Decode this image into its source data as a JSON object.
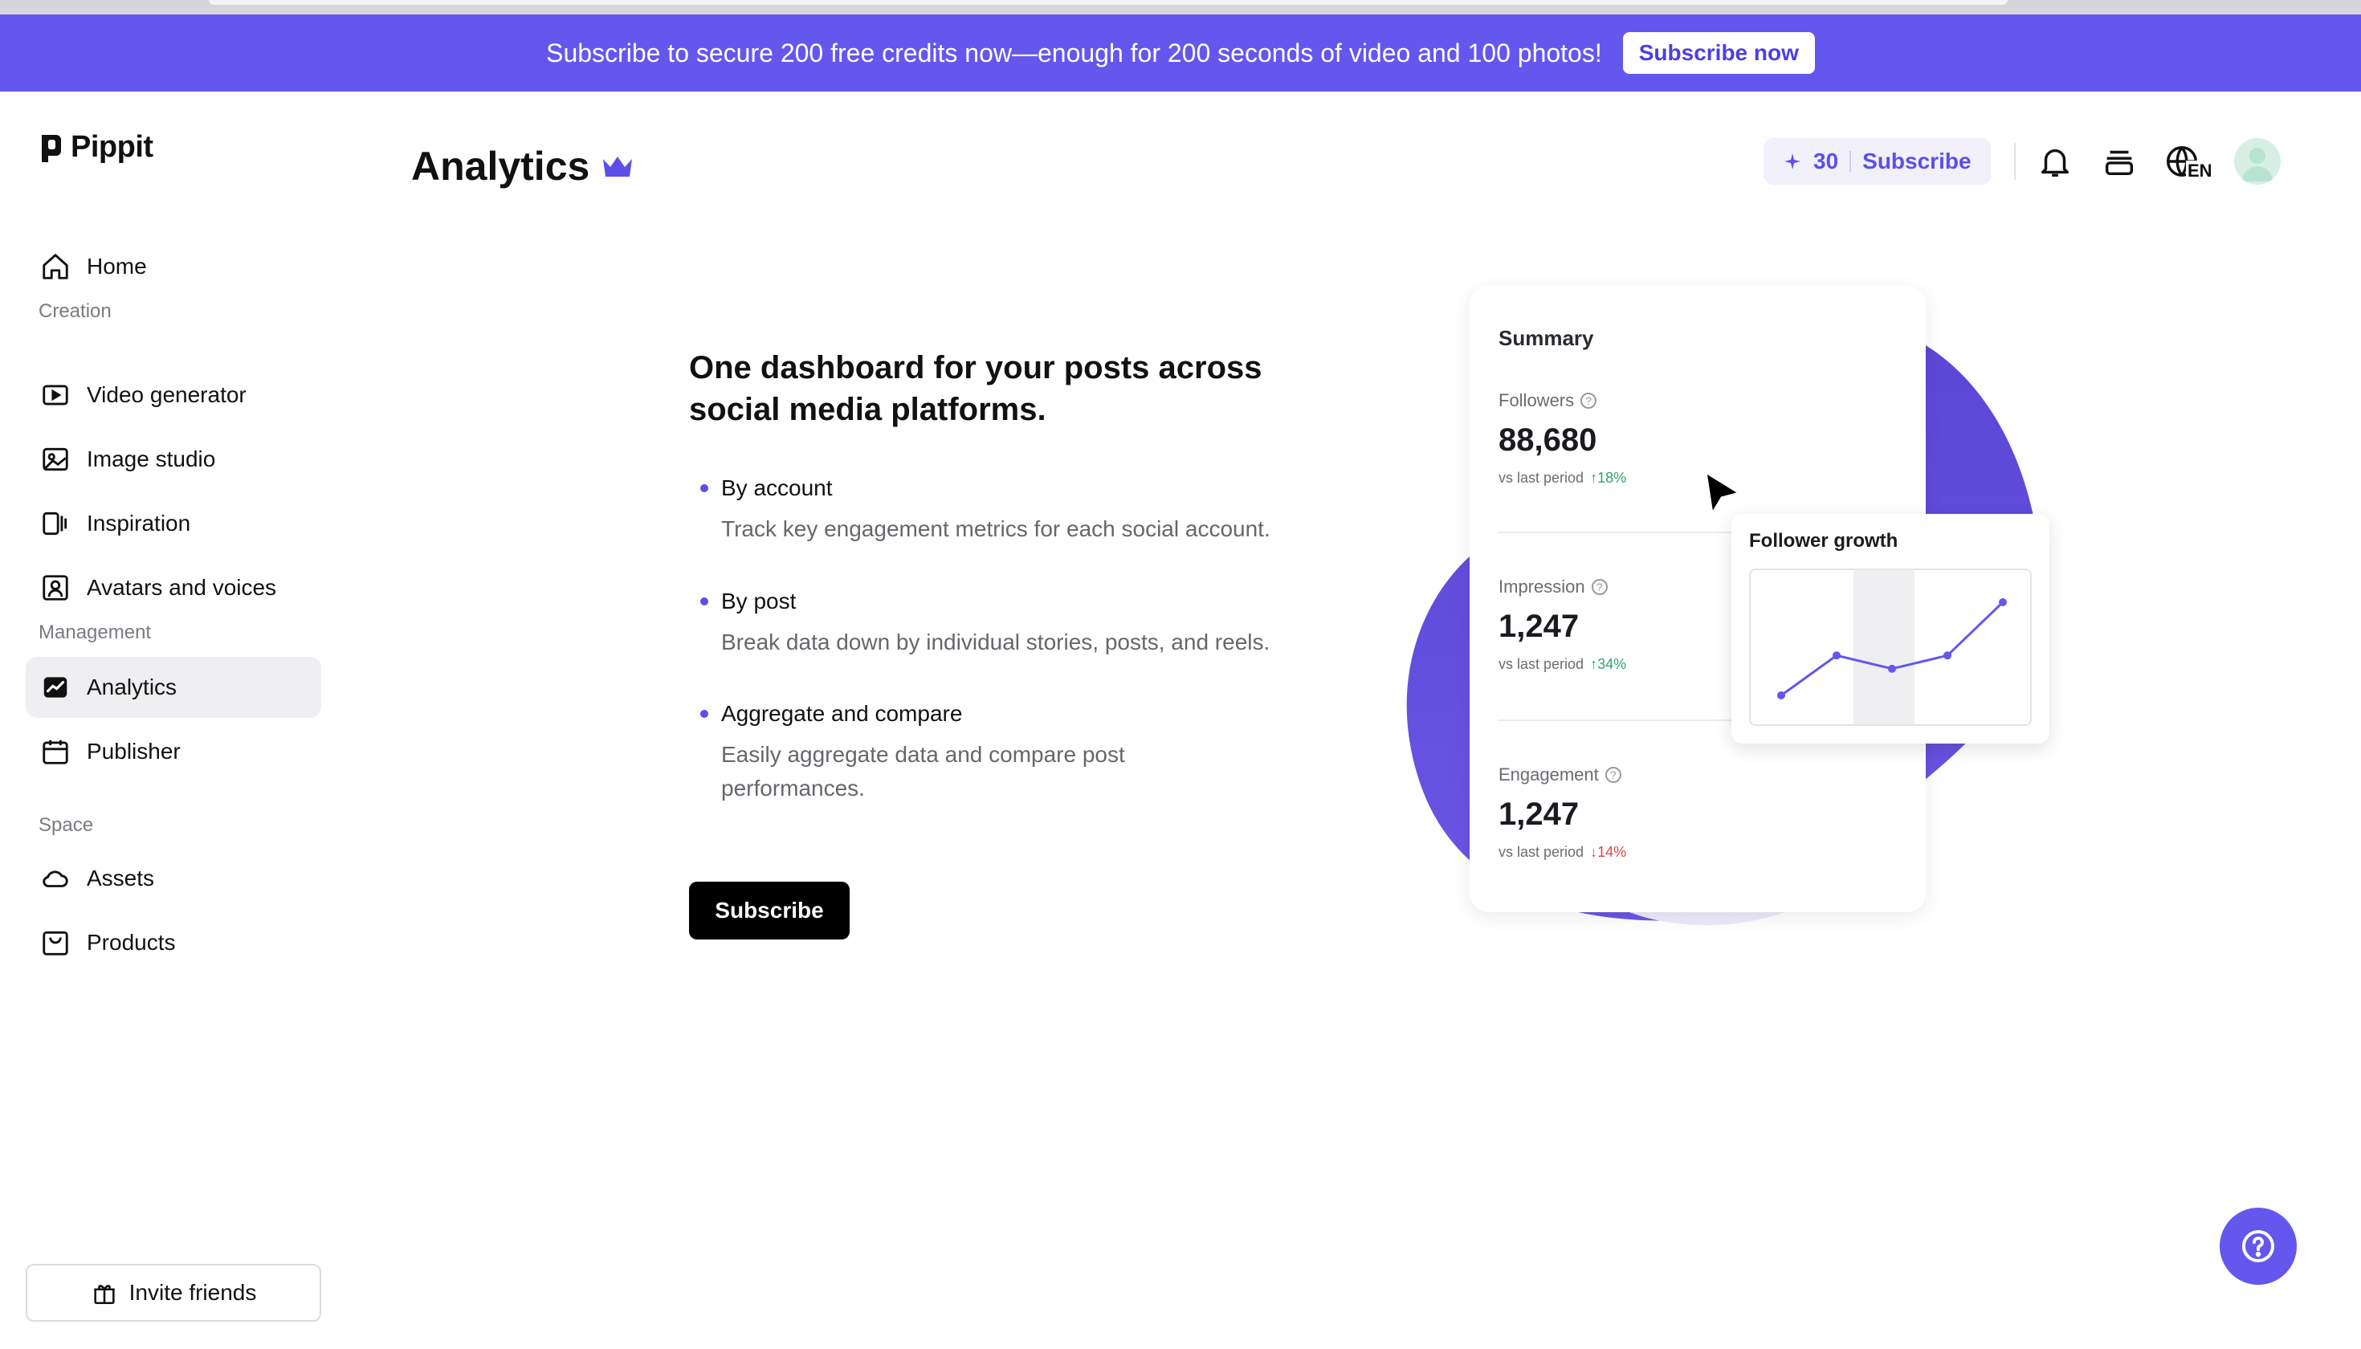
{
  "banner": {
    "text": "Subscribe to secure 200 free credits now—enough for 200 seconds of video and 100 photos!",
    "button_label": "Subscribe now"
  },
  "sidebar": {
    "logo_text": "Pippit",
    "home_label": "Home",
    "sections": {
      "creation": "Creation",
      "management": "Management",
      "space": "Space"
    },
    "items": [
      {
        "label": "Video generator",
        "icon": "video-generator-icon"
      },
      {
        "label": "Image studio",
        "icon": "image-studio-icon"
      },
      {
        "label": "Inspiration",
        "icon": "inspiration-icon"
      },
      {
        "label": "Avatars and voices",
        "icon": "avatar-icon"
      },
      {
        "label": "Analytics",
        "icon": "analytics-icon",
        "active": true
      },
      {
        "label": "Publisher",
        "icon": "calendar-icon"
      },
      {
        "label": "Assets",
        "icon": "cloud-icon"
      },
      {
        "label": "Products",
        "icon": "product-box-icon"
      }
    ],
    "invite_label": "Invite friends"
  },
  "header": {
    "title": "Analytics",
    "credits_count": "30",
    "subscribe_label": "Subscribe",
    "language": "EN"
  },
  "promo": {
    "heading": "One dashboard for your posts across social media platforms.",
    "features": [
      {
        "title": "By account",
        "description": "Track key engagement metrics for each social account."
      },
      {
        "title": "By post",
        "description": "Break data down by individual stories, posts, and reels."
      },
      {
        "title": "Aggregate and compare",
        "description": "Easily aggregate data and compare post performances."
      }
    ],
    "subscribe_label": "Subscribe"
  },
  "summary_card": {
    "title": "Summary",
    "metrics": [
      {
        "label": "Followers",
        "value": "88,680",
        "compare_label": "vs last period",
        "change": "18%",
        "direction": "up"
      },
      {
        "label": "Impression",
        "value": "1,247",
        "compare_label": "vs last period",
        "change": "34%",
        "direction": "up"
      },
      {
        "label": "Engagement",
        "value": "1,247",
        "compare_label": "vs last period",
        "change": "14%",
        "direction": "down"
      }
    ],
    "growth_title": "Follower growth",
    "growth_values": [
      1,
      4,
      3,
      4,
      8
    ]
  },
  "colors": {
    "accent": "#6457ee",
    "up": "#2fa56a",
    "down": "#e0464b"
  }
}
